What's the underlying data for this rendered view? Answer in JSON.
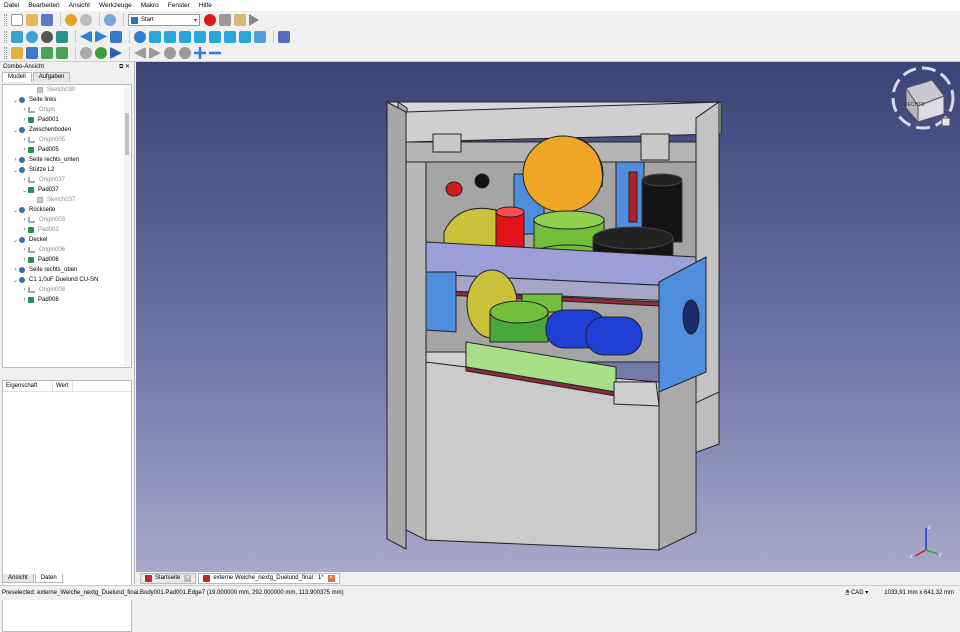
{
  "menu": [
    "Datei",
    "Bearbeiten",
    "Ansicht",
    "Werkzeuge",
    "Makro",
    "Fenster",
    "Hilfe"
  ],
  "toolbar": {
    "workbench": "Start"
  },
  "combo": {
    "title": "Combo-Ansicht",
    "title_buttons": "⧉ ✕",
    "tabs": [
      "Modell",
      "Aufgaben"
    ],
    "bottom_tabs": [
      "Ansicht",
      "Daten"
    ]
  },
  "tree": [
    {
      "label": "Sketch030",
      "indent": 3,
      "icon": "sketch",
      "chev": "",
      "dim": true
    },
    {
      "label": "Seite links",
      "indent": 1,
      "icon": "body",
      "chev": "⌄",
      "dim": false
    },
    {
      "label": "Origin",
      "indent": 2,
      "icon": "origin",
      "chev": "›",
      "dim": true
    },
    {
      "label": "Pad001",
      "indent": 2,
      "icon": "pad",
      "chev": "›",
      "dim": false
    },
    {
      "label": "Zwischenboden",
      "indent": 1,
      "icon": "body",
      "chev": "⌄",
      "dim": false
    },
    {
      "label": "Origin005",
      "indent": 2,
      "icon": "origin",
      "chev": "›",
      "dim": true
    },
    {
      "label": "Pad005",
      "indent": 2,
      "icon": "pad",
      "chev": "›",
      "dim": false
    },
    {
      "label": "Seite rechts_unten",
      "indent": 1,
      "icon": "body",
      "chev": "›",
      "dim": false
    },
    {
      "label": "Stütze L2",
      "indent": 1,
      "icon": "body",
      "chev": "⌄",
      "dim": false
    },
    {
      "label": "Origin037",
      "indent": 2,
      "icon": "origin",
      "chev": "›",
      "dim": true
    },
    {
      "label": "Pad037",
      "indent": 2,
      "icon": "pad",
      "chev": "⌄",
      "dim": false
    },
    {
      "label": "Sketch037",
      "indent": 3,
      "icon": "sketch",
      "chev": "",
      "dim": true
    },
    {
      "label": "Rückseite",
      "indent": 1,
      "icon": "body",
      "chev": "⌄",
      "dim": false
    },
    {
      "label": "Origin003",
      "indent": 2,
      "icon": "origin",
      "chev": "›",
      "dim": true
    },
    {
      "label": "Pad003",
      "indent": 2,
      "icon": "pad",
      "chev": "›",
      "dim": true
    },
    {
      "label": "Deckel",
      "indent": 1,
      "icon": "body",
      "chev": "⌄",
      "dim": false
    },
    {
      "label": "Origin006",
      "indent": 2,
      "icon": "origin",
      "chev": "›",
      "dim": true
    },
    {
      "label": "Pad006",
      "indent": 2,
      "icon": "pad",
      "chev": "›",
      "dim": false
    },
    {
      "label": "Seite rechts_oben",
      "indent": 1,
      "icon": "body",
      "chev": "›",
      "dim": false
    },
    {
      "label": "C1 1,0uF Duelund CU-SN",
      "indent": 1,
      "icon": "body",
      "chev": "⌄",
      "dim": false
    },
    {
      "label": "Origin008",
      "indent": 2,
      "icon": "origin",
      "chev": "›",
      "dim": true
    },
    {
      "label": "Pad008",
      "indent": 2,
      "icon": "pad",
      "chev": "›",
      "dim": false
    }
  ],
  "props": {
    "col1": "Eigenschaft",
    "col2": "Wert"
  },
  "navcube": {
    "face": "RECHTS"
  },
  "axes": {
    "x": "x",
    "y": "y",
    "z": "z"
  },
  "doc_tabs": [
    {
      "label": "Startseite",
      "active": false
    },
    {
      "label": "externe Weiche_nextg_Duelund_final : 1*",
      "active": true
    }
  ],
  "status": {
    "message": "Preselected: externe_Weiche_nextg_Duelund_final.Body001.Pad001.Edge7 (19.000000 mm, 292.000000 mm, 113.900375 mm)",
    "nav_style": "CAD",
    "dimensions": "1033,91 mm x 641,32 mm"
  },
  "colors": {
    "background_top": "#3b4276",
    "background_bottom": "#aaa9cc",
    "cabinet": "#c9c9c9",
    "shelf": "#9c9fd8",
    "accent_blue": "#4f8edc",
    "cap_orange": "#f0a527",
    "cap_green": "#73bf3b",
    "cap_black": "#141414",
    "cap_blue": "#1e3fd6",
    "cap_red": "#e2131b",
    "cap_olive": "#c9c23a"
  }
}
